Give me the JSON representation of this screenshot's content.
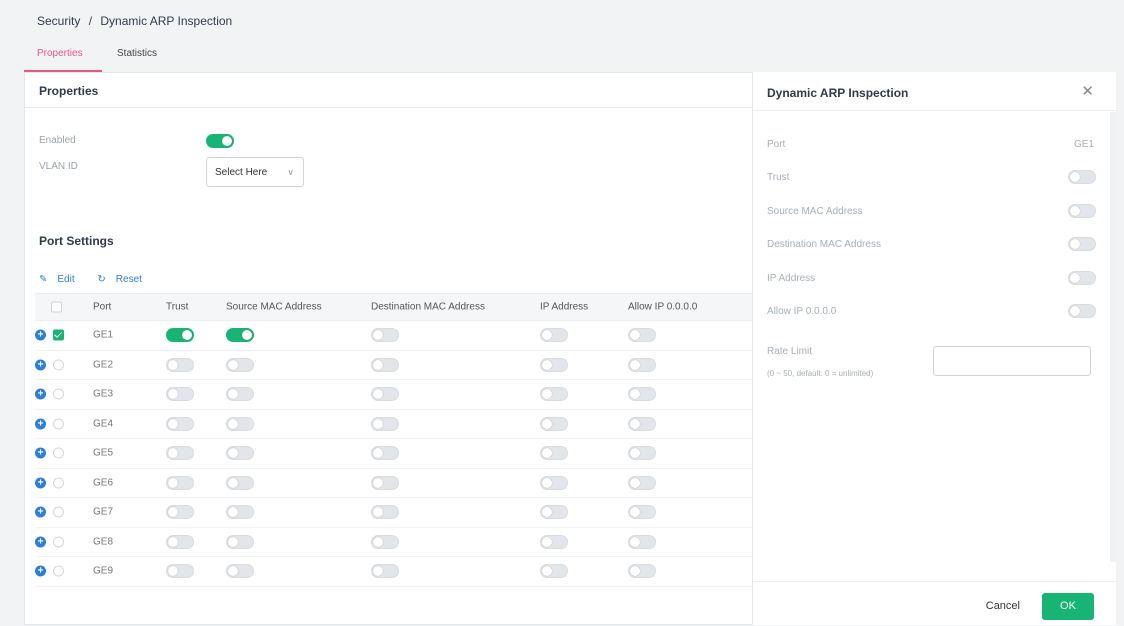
{
  "breadcrumb": {
    "section": "Security",
    "separator": "/",
    "page": "Dynamic ARP Inspection"
  },
  "tabs": [
    {
      "label": "Properties",
      "active": true
    },
    {
      "label": "Statistics",
      "active": false
    }
  ],
  "properties_panel": {
    "title": "Properties",
    "enabled_label": "Enabled",
    "enabled": true,
    "vlan_label": "VLAN ID",
    "vlan_select_placeholder": "Select Here"
  },
  "port_settings": {
    "title": "Port Settings",
    "edit_label": "Edit",
    "reset_label": "Reset",
    "columns": [
      "Port",
      "Trust",
      "Source MAC Address",
      "Destination MAC Address",
      "IP Address",
      "Allow IP 0.0.0.0"
    ],
    "rows": [
      {
        "port": "GE1",
        "checked": true,
        "trust": true,
        "src_mac": true,
        "dst_mac": false,
        "ip": false,
        "allow_ip": false
      },
      {
        "port": "GE2",
        "checked": false,
        "trust": false,
        "src_mac": false,
        "dst_mac": false,
        "ip": false,
        "allow_ip": false
      },
      {
        "port": "GE3",
        "checked": false,
        "trust": false,
        "src_mac": false,
        "dst_mac": false,
        "ip": false,
        "allow_ip": false
      },
      {
        "port": "GE4",
        "checked": false,
        "trust": false,
        "src_mac": false,
        "dst_mac": false,
        "ip": false,
        "allow_ip": false
      },
      {
        "port": "GE5",
        "checked": false,
        "trust": false,
        "src_mac": false,
        "dst_mac": false,
        "ip": false,
        "allow_ip": false
      },
      {
        "port": "GE6",
        "checked": false,
        "trust": false,
        "src_mac": false,
        "dst_mac": false,
        "ip": false,
        "allow_ip": false
      },
      {
        "port": "GE7",
        "checked": false,
        "trust": false,
        "src_mac": false,
        "dst_mac": false,
        "ip": false,
        "allow_ip": false
      },
      {
        "port": "GE8",
        "checked": false,
        "trust": false,
        "src_mac": false,
        "dst_mac": false,
        "ip": false,
        "allow_ip": false
      },
      {
        "port": "GE9",
        "checked": false,
        "trust": false,
        "src_mac": false,
        "dst_mac": false,
        "ip": false,
        "allow_ip": false
      }
    ]
  },
  "drawer": {
    "title": "Dynamic ARP Inspection",
    "close_icon": "close-icon",
    "port_label": "Port",
    "port_value": "GE1",
    "trust_label": "Trust",
    "trust": false,
    "src_mac_label": "Source MAC Address",
    "src_mac": false,
    "dst_mac_label": "Destination MAC Address",
    "dst_mac": false,
    "ip_label": "IP Address",
    "ip": false,
    "allow_ip_label": "Allow IP 0.0.0.0",
    "allow_ip": false,
    "rate_limit_label": "Rate Limit",
    "rate_limit_hint": "(0 ~ 50, default: 0 = unlimited)",
    "rate_limit_value": "",
    "cancel_label": "Cancel",
    "ok_label": "OK"
  },
  "colors": {
    "accent_green": "#18b473",
    "tab_pink": "#e75a7c",
    "link_blue": "#2e7fd9"
  }
}
